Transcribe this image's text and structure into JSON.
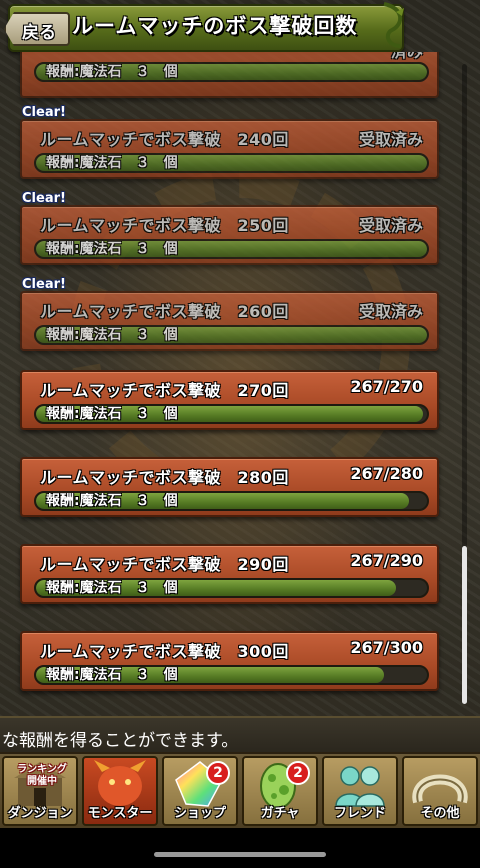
{
  "header": {
    "title": "ルームマッチのボス撃破回数",
    "back_label": "戻る"
  },
  "list": {
    "partial_top": {
      "status": "済み",
      "reward": "報酬:魔法石　３　個"
    },
    "missions": [
      {
        "clear_label": "Clear!",
        "title": "ルームマッチでボス撃破　240回",
        "status": "受取済み",
        "reward": "報酬:魔法石　３　個",
        "progress": 1.0
      },
      {
        "clear_label": "Clear!",
        "title": "ルームマッチでボス撃破　250回",
        "status": "受取済み",
        "reward": "報酬:魔法石　３　個",
        "progress": 1.0
      },
      {
        "clear_label": "Clear!",
        "title": "ルームマッチでボス撃破　260回",
        "status": "受取済み",
        "reward": "報酬:魔法石　３　個",
        "progress": 1.0
      },
      {
        "title": "ルームマッチでボス撃破　270回",
        "status": "267/270",
        "reward": "報酬:魔法石　３　個",
        "progress": 0.989
      },
      {
        "title": "ルームマッチでボス撃破　280回",
        "status": "267/280",
        "reward": "報酬:魔法石　３　個",
        "progress": 0.954
      },
      {
        "title": "ルームマッチでボス撃破　290回",
        "status": "267/290",
        "reward": "報酬:魔法石　３　個",
        "progress": 0.921
      },
      {
        "title": "ルームマッチでボス撃破　300回",
        "status": "267/300",
        "reward": "報酬:魔法石　３　個",
        "progress": 0.89
      }
    ]
  },
  "message": {
    "text": "な報酬を得ることができます。"
  },
  "nav": {
    "dungeon": {
      "label": "ダンジョン",
      "tag": "ランキング\n開催中"
    },
    "monster": {
      "label": "モンスター"
    },
    "shop": {
      "label": "ショップ",
      "badge": "2"
    },
    "gacha": {
      "label": "ガチャ",
      "badge": "2"
    },
    "friend": {
      "label": "フレンド"
    },
    "other": {
      "label": "その他"
    }
  },
  "colors": {
    "card": "#b0502a",
    "bar_fill": "#5f8a2c",
    "header": "#5c7120"
  }
}
